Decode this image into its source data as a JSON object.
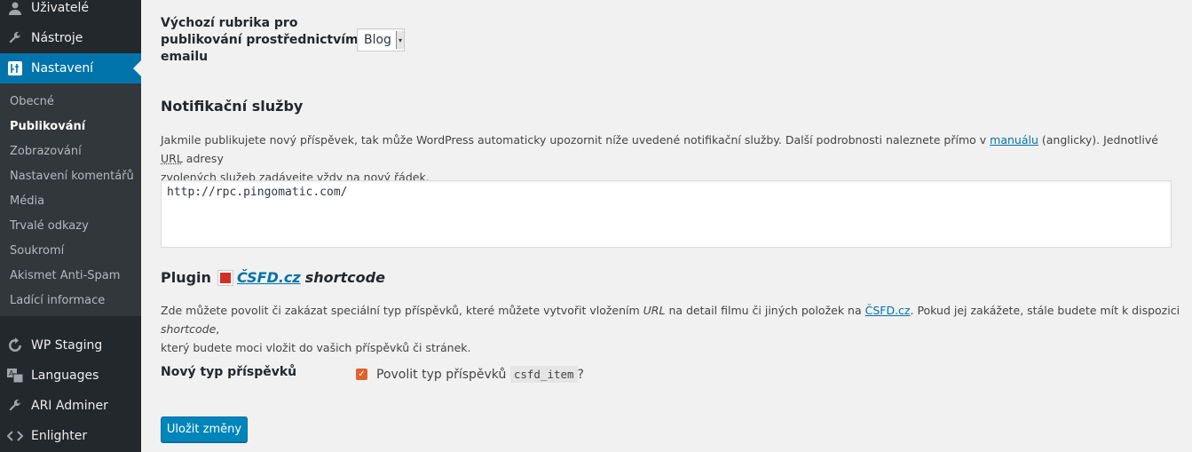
{
  "sidebar": {
    "menu": [
      {
        "label": "Uživatelé",
        "icon": "users-icon"
      },
      {
        "label": "Nástroje",
        "icon": "wrench-icon"
      },
      {
        "label": "Nastavení",
        "icon": "settings-icon"
      }
    ],
    "submenu": [
      "Obecné",
      "Publikování",
      "Zobrazování",
      "Nastavení komentářů",
      "Média",
      "Trvalé odkazy",
      "Soukromí",
      "Akismet Anti-Spam",
      "Ladící informace"
    ],
    "plugins": [
      {
        "label": "WP Staging",
        "icon": "refresh-icon"
      },
      {
        "label": "Languages",
        "icon": "translate-icon"
      },
      {
        "label": "ARI Adminer",
        "icon": "wrench-icon"
      },
      {
        "label": "Enlighter",
        "icon": "code-icon"
      }
    ]
  },
  "email_category": {
    "label_line1": "Výchozí rubrika pro",
    "label_line2": "publikování prostřednictvím",
    "label_line3": "emailu",
    "selected": "Blog"
  },
  "notifications": {
    "heading": "Notifikační služby",
    "desc_a": "Jakmile publikujete nový příspěvek, tak může WordPress automaticky upozornit níže uvedené notifikační služby. Další podrobnosti naleznete přímo v ",
    "link": "manuálu",
    "desc_b": " (anglicky). Jednotlivé ",
    "abbr": "URL",
    "desc_c": " adresy",
    "desc_line2": "zvolených služeb zadávejte vždy na nový řádek.",
    "textarea_value": "http://rpc.pingomatic.com/"
  },
  "plugin": {
    "heading_prefix": "Plugin",
    "heading_link": "ČSFD.cz",
    "heading_suffix": "shortcode",
    "desc_a": "Zde můžete povolit či zakázat speciální typ příspěvků, které můžete vytvořit vložením ",
    "desc_url": "URL",
    "desc_b": " na detail filmu či jiných položek na ",
    "desc_link": "ČSFD.cz",
    "desc_c": ". Pokud jej zakážete, stále budete mít k dispozici ",
    "desc_em": "shortcode",
    "desc_d": ",",
    "desc_line2": "který budete moci vložit do vašich příspěvků či stránek.",
    "row_label": "Nový typ příspěvků",
    "checkbox_label": "Povolit typ příspěvků",
    "code": "csfd_item",
    "question": "?"
  },
  "save_label": "Uložit změny",
  "colors": {
    "accent": "#0073aa",
    "sidebar": "#23282d",
    "checkbox": "#e0632f"
  }
}
